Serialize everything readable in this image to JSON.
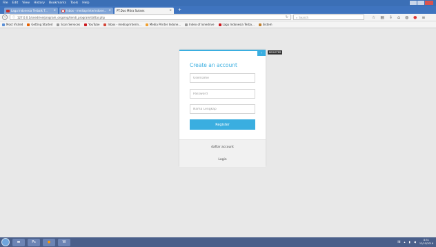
{
  "menu": [
    "File",
    "Edit",
    "View",
    "History",
    "Bookmarks",
    "Tools",
    "Help"
  ],
  "tabs": [
    {
      "label": "Lagu Indonesia Terbaik T...",
      "icon": "youtube-icon",
      "active": false
    },
    {
      "label": "Inbox - mediaprinterindone...",
      "icon": "gmail-icon",
      "active": false
    },
    {
      "label": "PT.Duo Mitra Sukses",
      "icon": "page-icon",
      "active": true
    }
  ],
  "url": "127.0.0.1/onedrive/program_ongoing/tendi_program/daftar.php",
  "search_placeholder": "Search",
  "bookmarks": [
    {
      "label": "Most Visited",
      "color": "#5a8fd6"
    },
    {
      "label": "Getting Started",
      "color": "#e66000"
    },
    {
      "label": "Scan Services",
      "color": "#999999"
    },
    {
      "label": "YouTube",
      "color": "#cc181e"
    },
    {
      "label": "Inbox - mediaprinterin...",
      "color": "#d44638"
    },
    {
      "label": "Media Printer Indone...",
      "color": "#f0a030"
    },
    {
      "label": "Index of /onedrive",
      "color": "#999999"
    },
    {
      "label": "Lagu Indonesia Terba...",
      "color": "#cc181e"
    },
    {
      "label": "Sistem",
      "color": "#c08030"
    }
  ],
  "form": {
    "title": "Create an account",
    "username_placeholder": "Username",
    "password_placeholder": "Password",
    "fullname_placeholder": "Nama Lengkap",
    "register_label": "Register",
    "daftar_link": "daftar account",
    "login_link": "Login",
    "side_label": "REGISTER",
    "accent": "#3aaee0"
  },
  "taskbar": {
    "apps": [
      "explorer",
      "Ps",
      "firefox",
      "W"
    ],
    "lang": "IN",
    "time": "8:31",
    "date": "12/10/2016"
  }
}
